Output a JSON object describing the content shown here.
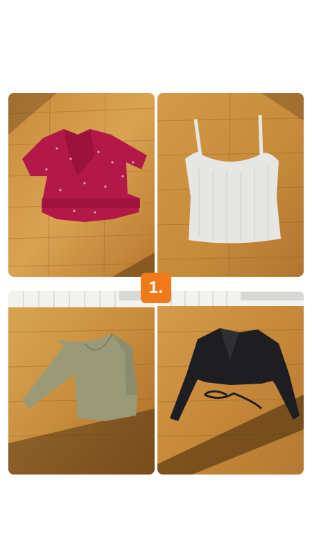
{
  "collage": {
    "badge_label": "1.",
    "badge_color": "#f07a1a",
    "photos": [
      {
        "subject": "magenta-wrap-crop-top",
        "top_color": "#b21848"
      },
      {
        "subject": "white-ribbed-tank-top",
        "top_color": "#e6e6e2"
      },
      {
        "subject": "olive-long-sleeve-top",
        "top_color": "#9a9a78"
      },
      {
        "subject": "black-long-sleeve-wrap-top",
        "top_color": "#1e1e22"
      }
    ]
  }
}
